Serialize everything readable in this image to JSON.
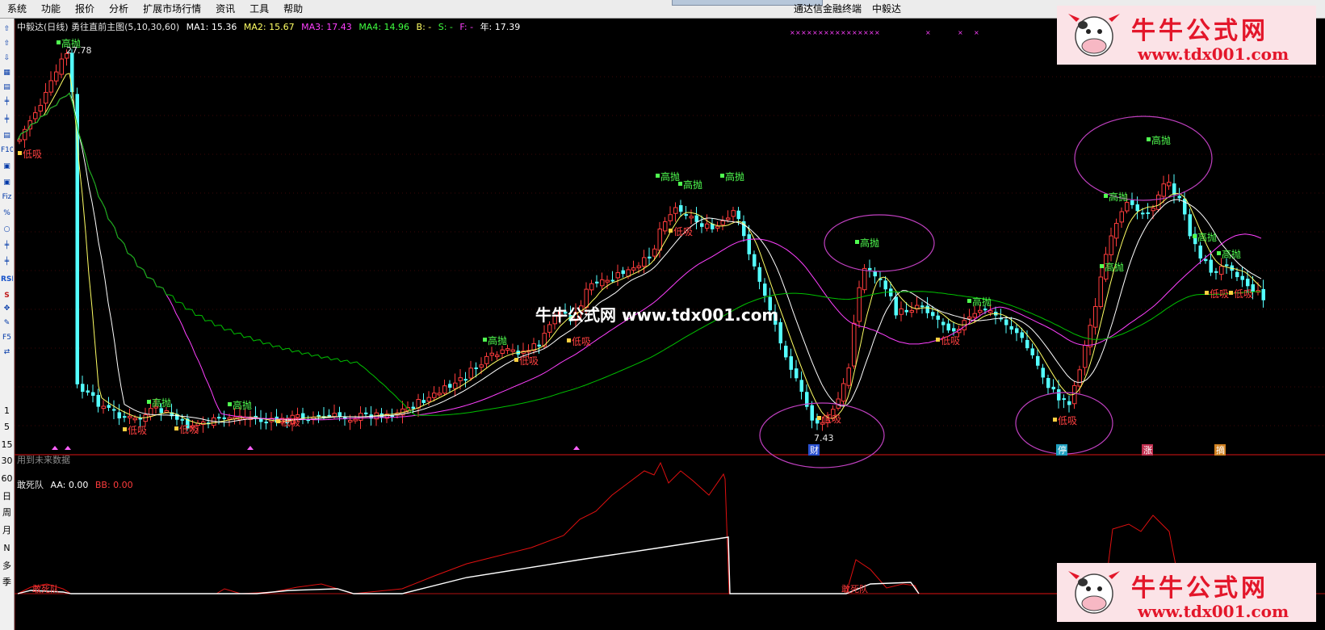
{
  "menu": [
    "系统",
    "功能",
    "报价",
    "分析",
    "扩展市场行情",
    "资讯",
    "工具",
    "帮助"
  ],
  "window": {
    "terminal_name": "通达信金融终端",
    "stock_name": "中毅达"
  },
  "toolbar": {
    "period_labels": [
      "1",
      "5",
      "15",
      "30",
      "60",
      "日",
      "周",
      "月",
      "N",
      "多",
      "季"
    ]
  },
  "main_info": {
    "title": "中毅达(日线) 勇往直前主图(5,10,30,60)",
    "ma1": "MA1: 15.36",
    "ma2": "MA2: 15.67",
    "ma3": "MA3: 17.43",
    "ma4": "MA4: 14.96",
    "b": "B: -",
    "s": "S: -",
    "f": "F: -",
    "year": "年: 17.39"
  },
  "colors": {
    "up": "#ff3c3c",
    "down": "#54ffff",
    "ma1": "#ffffff",
    "ma2": "#ffff64",
    "ma3": "#ff40ff",
    "ma4": "#00c000",
    "bigline": "#ffffff",
    "buy": "#ff4040",
    "sell": "#50ff50",
    "circle": "#c040c0"
  },
  "sub_info": {
    "title": "敢死队",
    "aa": "AA: 0.00",
    "bb": "BB: 0.00"
  },
  "future_data_label": "用到未来数据",
  "labels": {
    "high": "高抛",
    "low": "低吸",
    "price_high": "27.78",
    "price_low": "7.43",
    "cai": "财",
    "ting": "停",
    "zhang": "涨",
    "zhai": "摘",
    "gsd": "敢死队"
  },
  "watermark": {
    "text": "牛牛公式网  www.tdx001.com",
    "logo_title": "牛牛公式网",
    "logo_url": "www.tdx001.com"
  },
  "icons": [
    "up-arrow-icon",
    "down-arrow-icon",
    "grid-icon",
    "chart-icon",
    "kline-icon",
    "f10-icon",
    "info-icon",
    "fiz-icon",
    "percent-icon",
    "circle-icon",
    "rsi-icon",
    "s-icon",
    "move-icon",
    "pen-icon",
    "f5-icon",
    "switch-icon"
  ]
}
